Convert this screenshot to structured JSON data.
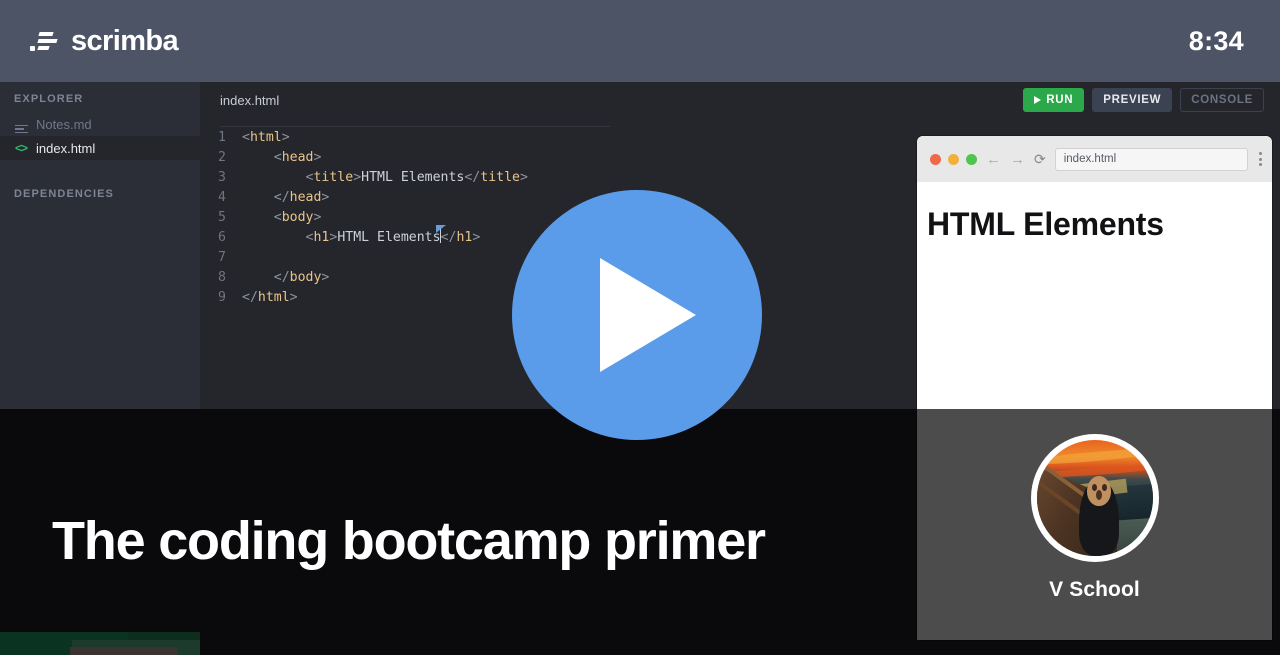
{
  "header": {
    "brand": "scrimba",
    "logo_icon": "scrimba-logo-icon",
    "timer": "8:34"
  },
  "sidebar": {
    "explorer_header": "EXPLORER",
    "dependencies_header": "DEPENDENCIES",
    "files": [
      {
        "name": "Notes.md",
        "icon": "lines-icon",
        "active": false
      },
      {
        "name": "index.html",
        "icon": "code-icon",
        "active": true
      }
    ]
  },
  "editor": {
    "tab_label": "index.html",
    "buttons": {
      "run": "RUN",
      "run_icon": "play-icon",
      "preview": "PREVIEW",
      "console": "CONSOLE"
    },
    "code_lines": [
      {
        "n": "1",
        "indent": 0,
        "segments": [
          {
            "t": "<",
            "c": "br"
          },
          {
            "t": "html",
            "c": "tg"
          },
          {
            "t": ">",
            "c": "br"
          }
        ]
      },
      {
        "n": "2",
        "indent": 4,
        "segments": [
          {
            "t": "<",
            "c": "br"
          },
          {
            "t": "head",
            "c": "tg"
          },
          {
            "t": ">",
            "c": "br"
          }
        ]
      },
      {
        "n": "3",
        "indent": 8,
        "segments": [
          {
            "t": "<",
            "c": "br"
          },
          {
            "t": "title",
            "c": "tg"
          },
          {
            "t": ">",
            "c": "br"
          },
          {
            "t": "HTML Elements",
            "c": "src"
          },
          {
            "t": "</",
            "c": "br"
          },
          {
            "t": "title",
            "c": "tg"
          },
          {
            "t": ">",
            "c": "br"
          }
        ]
      },
      {
        "n": "4",
        "indent": 4,
        "segments": [
          {
            "t": "</",
            "c": "br"
          },
          {
            "t": "head",
            "c": "tg"
          },
          {
            "t": ">",
            "c": "br"
          }
        ]
      },
      {
        "n": "5",
        "indent": 4,
        "segments": [
          {
            "t": "<",
            "c": "br"
          },
          {
            "t": "body",
            "c": "tg"
          },
          {
            "t": ">",
            "c": "br"
          }
        ]
      },
      {
        "n": "6",
        "indent": 8,
        "segments": [
          {
            "t": "<",
            "c": "br"
          },
          {
            "t": "h1",
            "c": "tg"
          },
          {
            "t": ">",
            "c": "br"
          },
          {
            "t": "HTML Elements",
            "c": "src"
          },
          {
            "t": "",
            "c": "cursor"
          },
          {
            "t": "</",
            "c": "br"
          },
          {
            "t": "h1",
            "c": "tg"
          },
          {
            "t": ">",
            "c": "br"
          }
        ]
      },
      {
        "n": "7",
        "indent": 0,
        "segments": []
      },
      {
        "n": "8",
        "indent": 4,
        "segments": [
          {
            "t": "</",
            "c": "br"
          },
          {
            "t": "body",
            "c": "tg"
          },
          {
            "t": ">",
            "c": "br"
          }
        ]
      },
      {
        "n": "9",
        "indent": 0,
        "segments": [
          {
            "t": "</",
            "c": "br"
          },
          {
            "t": "html",
            "c": "tg"
          },
          {
            "t": ">",
            "c": "br"
          }
        ]
      }
    ]
  },
  "preview": {
    "url": "index.html",
    "traffic_lights": [
      "#ed6a4b",
      "#f2b03c",
      "#4fc54f"
    ],
    "back_icon": "arrow-left-icon",
    "forward_icon": "arrow-right-icon",
    "reload_icon": "reload-icon",
    "menu_icon": "kebab-menu-icon",
    "page_heading": "HTML Elements",
    "avatar_label": "V School",
    "avatar_icon": "the-scream-avatar"
  },
  "overlay": {
    "play_icon": "play-button-icon",
    "title": "The coding bootcamp primer"
  },
  "colors": {
    "header_bg": "#4c5465",
    "sidebar_bg": "#2b2e37",
    "editor_bg": "#24262b",
    "accent_run": "#2ba84a",
    "accent_play": "#5a9bea",
    "code_tag": "#e8c48b"
  }
}
